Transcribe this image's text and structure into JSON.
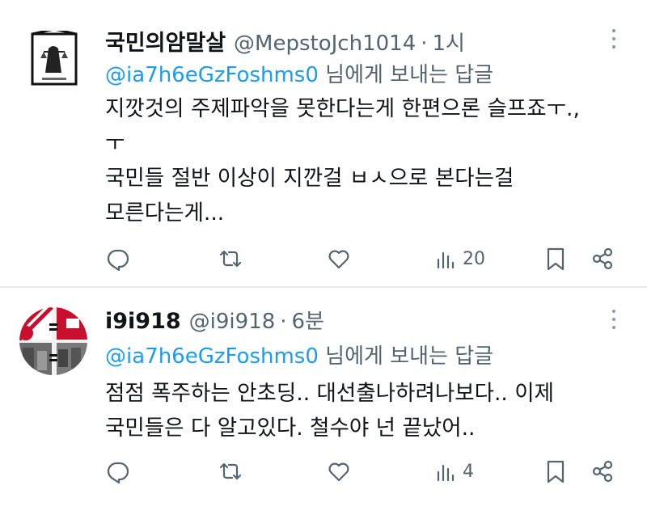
{
  "tweets": [
    {
      "name": "국민의암말살",
      "handle": "@MepstoJch1014",
      "time": "1시",
      "reply_to": "@ia7h6eGzFoshms0",
      "reply_suffix": " 님에게 보내는 답글",
      "lines": [
        "지깟것의 주제파악을 못한다는게 한편으론 슬프죠ㅜ.,",
        "ㅜ",
        "국민들 절반 이상이 지깐걸 ㅂㅅ으로 본다는걸",
        "모른다는게..."
      ],
      "views": "20"
    },
    {
      "name": "i9i918",
      "handle": "@i9i918",
      "time": "6분",
      "reply_to": "@ia7h6eGzFoshms0",
      "reply_suffix": " 님에게 보내는 답글",
      "lines": [
        "점점 폭주하는 안초딩.. 대선출나하려나보다.. 이제",
        "국민들은 다 알고있다. 철수야 넌 끝났어.."
      ],
      "views": "4"
    }
  ],
  "icons": [
    "reply-icon",
    "retweet-icon",
    "like-icon",
    "views-icon",
    "bookmark-icon",
    "share-icon",
    "more-icon"
  ],
  "colors": {
    "text": "#0f1419",
    "secondary": "#536471",
    "mention": "#1d9bf0",
    "divider": "#e9ecef"
  }
}
